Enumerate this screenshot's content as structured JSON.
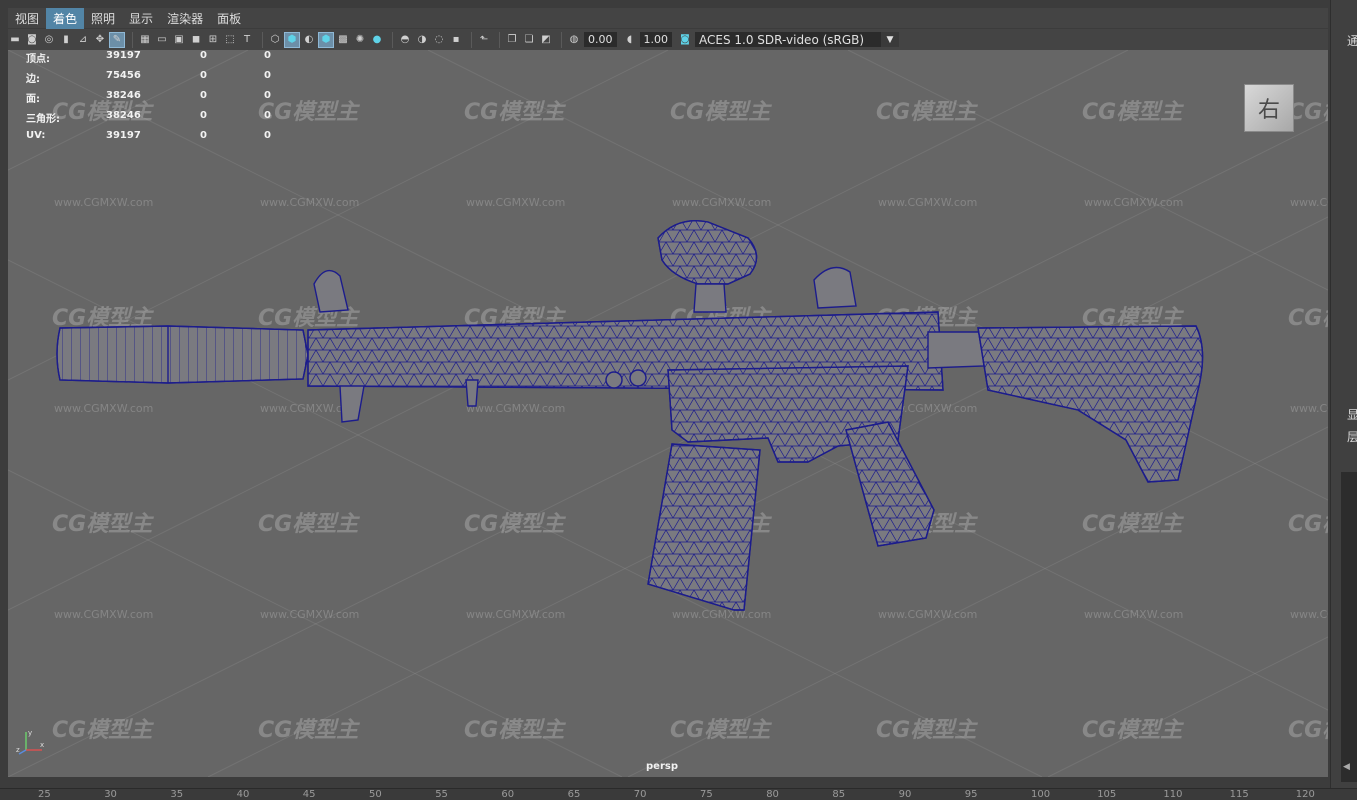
{
  "menubar": {
    "items": [
      "视图",
      "着色",
      "照明",
      "显示",
      "渲染器",
      "面板"
    ],
    "active_index": 1
  },
  "toolbar": {
    "exposure_value": "0.00",
    "gamma_value": "1.00",
    "color_management": "ACES 1.0 SDR-video (sRGB)"
  },
  "hud": {
    "rows": [
      {
        "label": "顶点:",
        "v1": "39197",
        "v2": "0",
        "v3": "0"
      },
      {
        "label": "边:",
        "v1": "75456",
        "v2": "0",
        "v3": "0"
      },
      {
        "label": "面:",
        "v1": "38246",
        "v2": "0",
        "v3": "0"
      },
      {
        "label": "三角形:",
        "v1": "38246",
        "v2": "0",
        "v3": "0"
      },
      {
        "label": "UV:",
        "v1": "39197",
        "v2": "0",
        "v3": "0"
      }
    ]
  },
  "viewport": {
    "camera": "persp",
    "viewcube_label": "右",
    "axis_labels": [
      "y",
      "z",
      "x"
    ],
    "background_color": "#666666",
    "wireframe_color": "#1c1c8c",
    "watermark_logo": "CG模型主",
    "watermark_url": "www.CGMXW.com"
  },
  "ruler": {
    "ticks": [
      "25",
      "30",
      "35",
      "40",
      "45",
      "50",
      "55",
      "60",
      "65",
      "70",
      "75",
      "80",
      "85",
      "90",
      "95",
      "100",
      "105",
      "110",
      "115",
      "120"
    ]
  },
  "right_panel": {
    "top_text": "通",
    "mid_text_1": "显",
    "mid_text_2": "层"
  },
  "colors": {
    "menu_active": "#5285a6",
    "accent_cyan": "#5fd3e8"
  }
}
